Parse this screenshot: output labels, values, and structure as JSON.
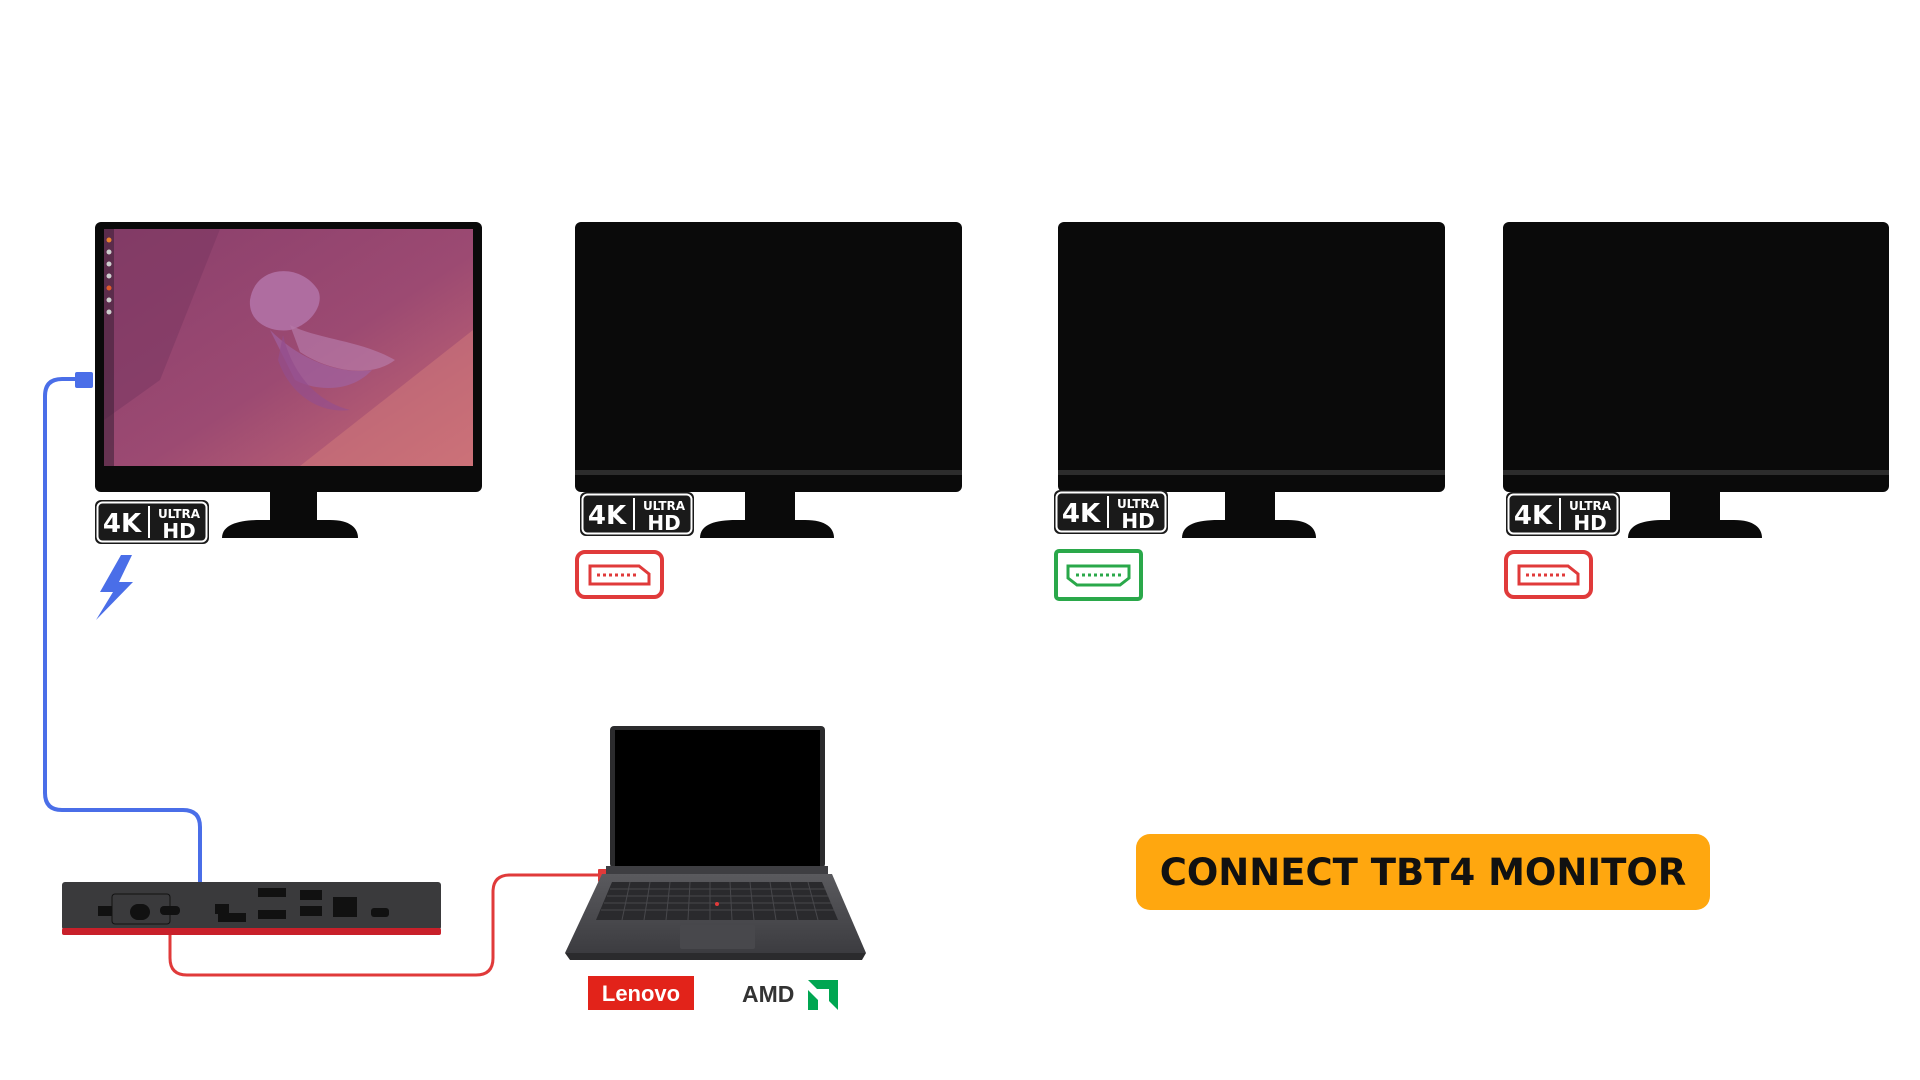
{
  "monitors": [
    {
      "badge": {
        "big": "4K",
        "small_top": "ULTRA",
        "small_bottom": "HD"
      },
      "screen": "desktop-wallpaper",
      "port_icon": "thunderbolt-icon"
    },
    {
      "badge": {
        "big": "4K",
        "small_top": "ULTRA",
        "small_bottom": "HD"
      },
      "screen": "black",
      "port_icon": "displayport-icon"
    },
    {
      "badge": {
        "big": "4K",
        "small_top": "ULTRA",
        "small_bottom": "HD"
      },
      "screen": "black",
      "port_icon": "hdmi-icon"
    },
    {
      "badge": {
        "big": "4K",
        "small_top": "ULTRA",
        "small_bottom": "HD"
      },
      "screen": "black",
      "port_icon": "displayport-icon"
    }
  ],
  "logos": {
    "lenovo": "Lenovo",
    "amd": "AMD"
  },
  "cta": {
    "label": "CONNECT TBT4 MONITOR"
  },
  "colors": {
    "tbt_cable": "#4a6ee8",
    "laptop_cable": "#e03a3a",
    "hdmi_port": "#2aa84a",
    "displayport_port": "#e03a3a",
    "cta_background": "#ffa70f",
    "lenovo_red": "#e2231a",
    "amd_green": "#00a651"
  }
}
